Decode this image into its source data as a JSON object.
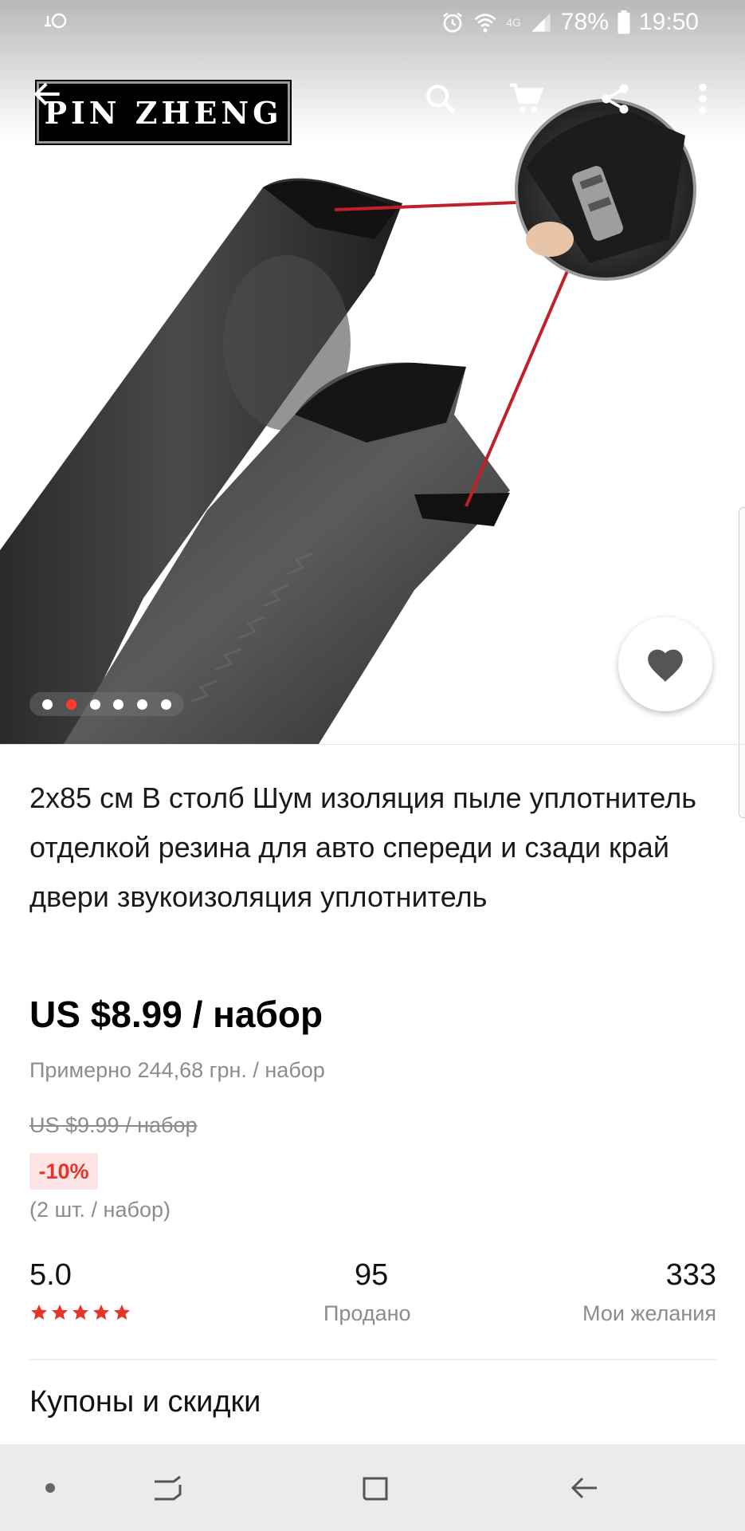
{
  "status_bar": {
    "battery_percent": "78%",
    "time": "19:50",
    "network": "4G"
  },
  "toolbar": {
    "logo_text": "PIN ZHENG",
    "icons": [
      "back-arrow-icon",
      "search-icon",
      "cart-icon",
      "share-icon",
      "more-icon"
    ]
  },
  "gallery": {
    "image_count": 6,
    "active_index": 1
  },
  "product": {
    "title": "2x85 см В столб Шум изоляция пыле уплотнитель отделкой резина для авто спереди и сзади край двери звукоизоляция уплотнитель",
    "price": "US $8.99 / набор",
    "approx_price": "Примерно 244,68 грн. / набор",
    "old_price": "US $9.99 / набор",
    "discount": "-10%",
    "pack_info": "(2 шт. / набор)"
  },
  "stats": {
    "rating": "5.0",
    "stars": 5,
    "sold_count": "95",
    "sold_label": "Продано",
    "wishlist_count": "333",
    "wishlist_label": "Мои желания"
  },
  "coupons": {
    "title": "Купоны и скидки"
  },
  "colors": {
    "accent": "#e5352b",
    "dot_active": "#ff3b30",
    "nav_bar": "#ebebeb"
  }
}
